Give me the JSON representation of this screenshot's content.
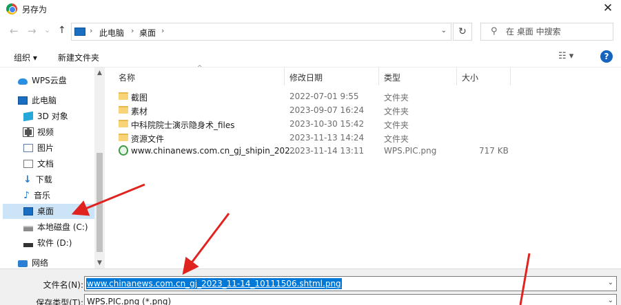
{
  "window": {
    "title": "另存为",
    "close_label": "✕"
  },
  "nav": {
    "back": "←",
    "forward": "→",
    "dropdown": "⌄",
    "up": "↑",
    "breadcrumbs": [
      "此电脑",
      "桌面"
    ],
    "separator": "›",
    "refresh": "↻",
    "search_placeholder": "在 桌面 中搜索"
  },
  "toolbar": {
    "organize_label": "组织 ▾",
    "new_folder_label": "新建文件夹",
    "view_label": "☷ ▾",
    "help_label": "?"
  },
  "sidebar": {
    "items": [
      {
        "label": "WPS云盘",
        "icon": "cloud-icon"
      },
      {
        "label": "此电脑",
        "icon": "pc-icon"
      },
      {
        "label": "3D 对象",
        "icon": "cube-icon"
      },
      {
        "label": "视频",
        "icon": "video-icon"
      },
      {
        "label": "图片",
        "icon": "picture-icon"
      },
      {
        "label": "文档",
        "icon": "document-icon"
      },
      {
        "label": "下载",
        "icon": "download-icon"
      },
      {
        "label": "音乐",
        "icon": "music-icon"
      },
      {
        "label": "桌面",
        "icon": "desktop-icon",
        "selected": true
      },
      {
        "label": "本地磁盘 (C:)",
        "icon": "disk-icon"
      },
      {
        "label": "软件 (D:)",
        "icon": "disk-icon"
      },
      {
        "label": "网络",
        "icon": "network-icon"
      }
    ]
  },
  "columns": {
    "name": "名称",
    "date": "修改日期",
    "type": "类型",
    "size": "大小"
  },
  "files": [
    {
      "name": "截图",
      "date": "2022-07-01 9:55",
      "type": "文件夹",
      "size": "",
      "kind": "folder"
    },
    {
      "name": "素材",
      "date": "2023-09-07 16:24",
      "type": "文件夹",
      "size": "",
      "kind": "folder"
    },
    {
      "name": "中科院院士演示隐身术_files",
      "date": "2023-10-30 15:42",
      "type": "文件夹",
      "size": "",
      "kind": "folder"
    },
    {
      "name": "资源文件",
      "date": "2023-11-13 14:24",
      "type": "文件夹",
      "size": "",
      "kind": "folder"
    },
    {
      "name": "www.chinanews.com.cn_gj_shipin_202...",
      "date": "2023-11-14 13:11",
      "type": "WPS.PIC.png",
      "size": "717 KB",
      "kind": "png"
    }
  ],
  "save": {
    "filename_label": "文件名(N):",
    "filename_value": "www.chinanews.com.cn_gj_2023_11-14_10111506.shtml.png",
    "filetype_label": "保存类型(T):",
    "filetype_value": "WPS.PIC.png (*.png)"
  },
  "colors": {
    "selection": "#0078d7",
    "sidebar_selected": "#cce4f7",
    "annotation_arrow": "#e0231f"
  }
}
